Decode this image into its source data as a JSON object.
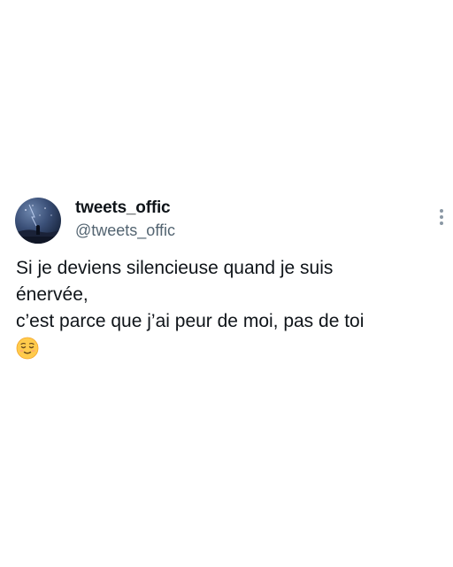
{
  "tweet": {
    "display_name": "tweets_offic",
    "handle": "@tweets_offic",
    "text_lines": [
      "Si je deviens silencieuse quand je suis",
      "énervée,",
      "c’est parce que j’ai peur de moi, pas de toi"
    ],
    "emoji": "relieved-face-emoji",
    "avatar_icon": "night-sky-avatar",
    "more_icon": "vertical-ellipsis-icon"
  },
  "colors": {
    "text_primary": "#0f1419",
    "text_secondary": "#536471",
    "background": "#ffffff",
    "emoji_face": "#ffcb4c"
  }
}
